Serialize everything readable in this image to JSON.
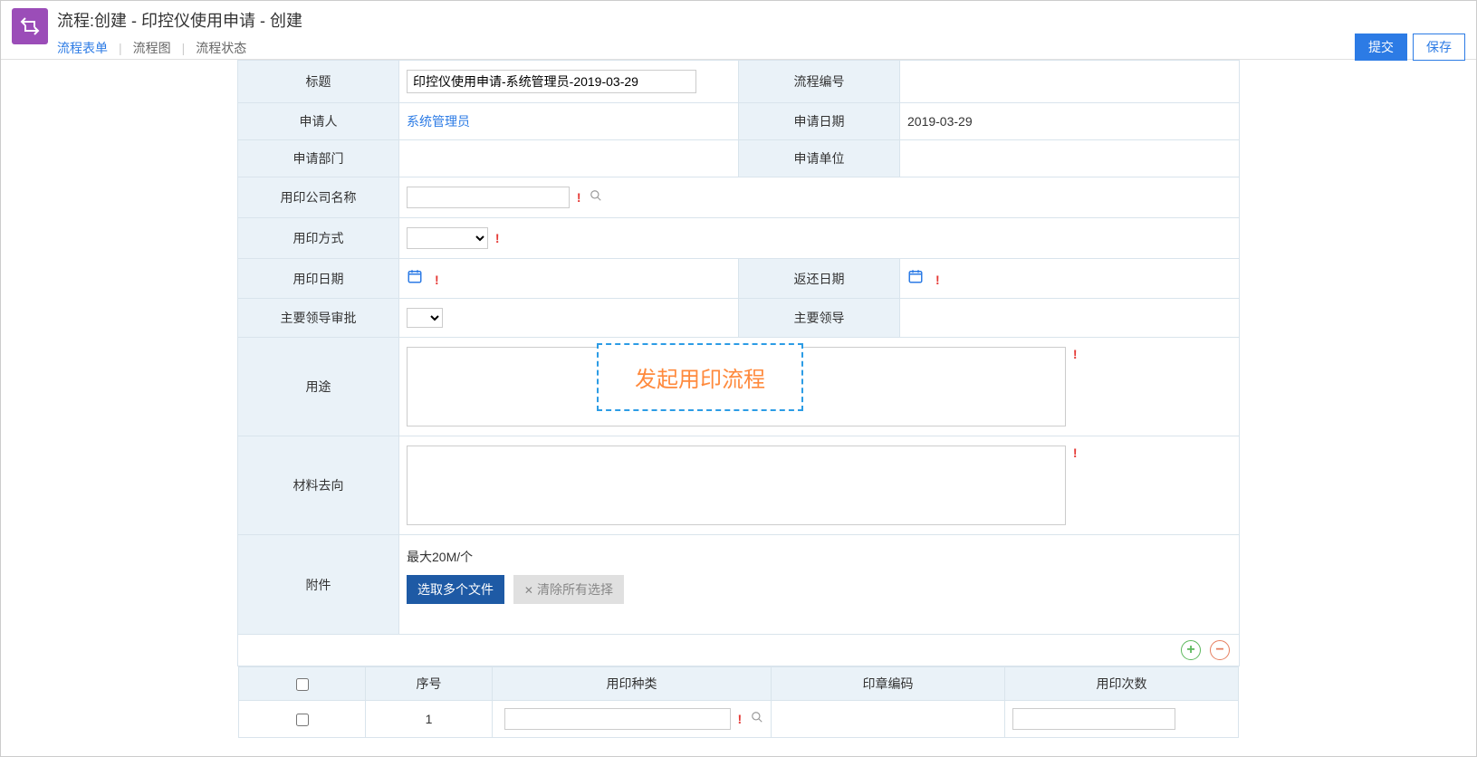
{
  "header": {
    "title": "流程:创建 - 印控仪使用申请 - 创建",
    "tabs": [
      "流程表单",
      "流程图",
      "流程状态"
    ],
    "submit": "提交",
    "save": "保存"
  },
  "form": {
    "labels": {
      "title": "标题",
      "processNo": "流程编号",
      "applicant": "申请人",
      "applyDate": "申请日期",
      "applyDept": "申请部门",
      "applyUnit": "申请单位",
      "company": "用印公司名称",
      "method": "用印方式",
      "useDate": "用印日期",
      "returnDate": "返还日期",
      "leaderApprove": "主要领导审批",
      "leader": "主要领导",
      "purpose": "用途",
      "materialDest": "材料去向",
      "attachment": "附件"
    },
    "values": {
      "title": "印控仪使用申请-系统管理员-2019-03-29",
      "applicant": "系统管理员",
      "applyDate": "2019-03-29",
      "attachHint": "最大20M/个",
      "selectFiles": "选取多个文件",
      "clearSelected": "清除所有选择"
    }
  },
  "callout": "发起用印流程",
  "subTable": {
    "headers": {
      "seq": "序号",
      "sealType": "用印种类",
      "sealCode": "印章编码",
      "count": "用印次数"
    },
    "rows": [
      {
        "seq": "1"
      }
    ]
  }
}
